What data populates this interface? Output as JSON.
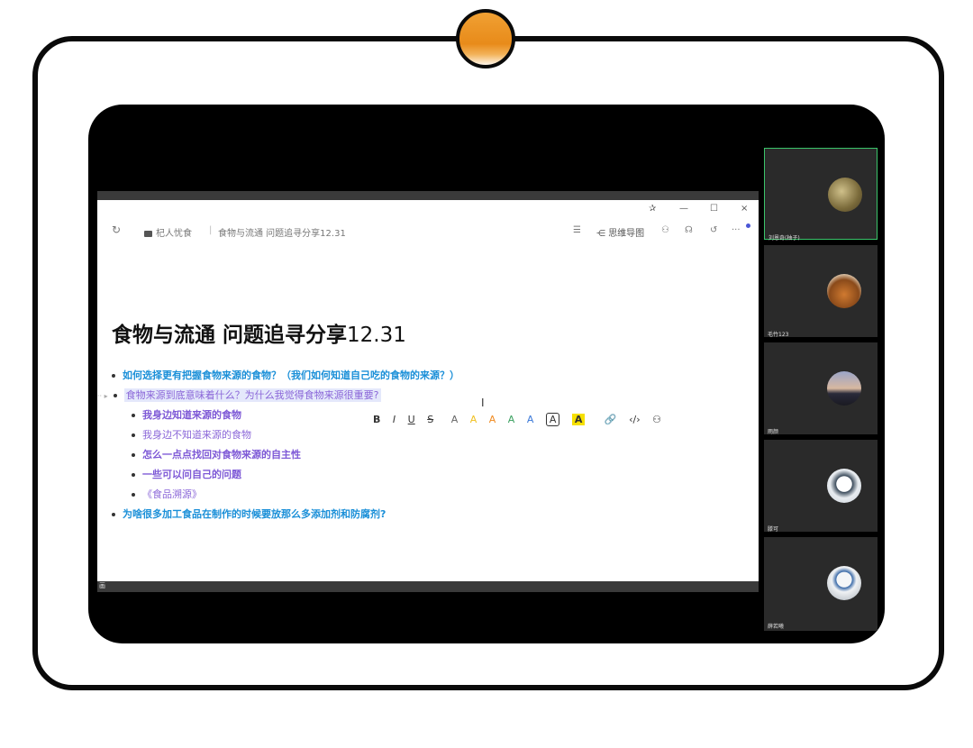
{
  "window": {
    "pin_glyph": "✰",
    "minimize_glyph": "—",
    "maximize_glyph": "☐",
    "close_glyph": "×"
  },
  "bottom_label": "画",
  "toolbar": {
    "refresh_glyph": "↻",
    "folder_label": "杞人忧食",
    "doc_path": "食物与流通 问题追寻分享12.31",
    "outline_glyph": "☰",
    "mindmap_label": "思维导图",
    "share_glyph": "⚇",
    "collab_glyph": "☊",
    "history_glyph": "↺",
    "more_glyph": "···"
  },
  "document": {
    "title_cn": "食物与流通 问题追寻分享",
    "title_num": "12.31",
    "items": [
      {
        "level": 1,
        "text": "如何选择更有把握食物来源的食物？（我们如何知道自己吃的食物的来源？）"
      },
      {
        "level": 2,
        "text": "食物来源到底意味着什么？为什么我觉得食物来源很重要?"
      },
      {
        "level": 2,
        "text": "我身边知道来源的食物"
      },
      {
        "level": 2,
        "text": "我身边不知道来源的食物"
      },
      {
        "level": 2,
        "text": "怎么一点点找回对食物来源的自主性"
      },
      {
        "level": 2,
        "text": "一些可以问自己的问题"
      },
      {
        "level": 2,
        "text": "《食品溯源》"
      },
      {
        "level": 1,
        "text": "为啥很多加工食品在制作的时候要放那么多添加剂和防腐剂?"
      }
    ]
  },
  "format_toolbar": {
    "bold": "B",
    "italic": "I",
    "underline": "U",
    "strike": "S",
    "colors": [
      "A",
      "A",
      "A",
      "A",
      "A"
    ],
    "boxed": "A",
    "filled": "A",
    "link_glyph": "🔗",
    "code_glyph": "‹/›",
    "more_glyph": "⚇"
  },
  "cursor_glyph": "I",
  "participants": [
    {
      "name": "刘恩奇(柚子)",
      "color": "#8a7a4a"
    },
    {
      "name": "毛竹123",
      "color": "#b06a30"
    },
    {
      "name": "雨颜",
      "color": "#6a6a8a"
    },
    {
      "name": "滕可",
      "color": "#d8dde4"
    },
    {
      "name": "薛若曦",
      "color": "#dfe4ea"
    }
  ]
}
